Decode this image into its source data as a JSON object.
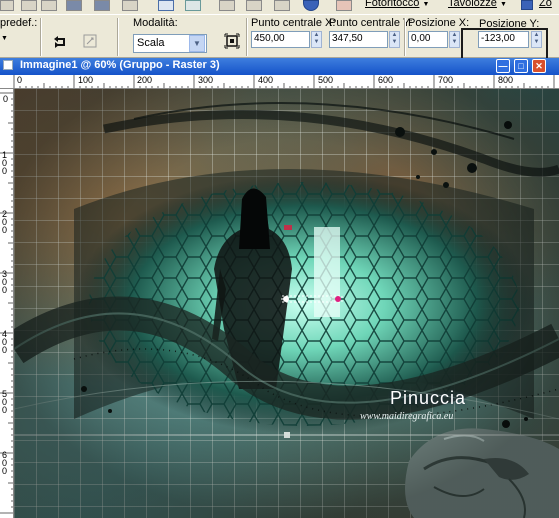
{
  "menu": {
    "photo_label": "Fotoritocco",
    "tables_label": "Tavolozze",
    "zoom_label": "Zo"
  },
  "options": {
    "preset_label": "predef.:",
    "mode_label": "Modalità:",
    "mode_value": "Scala",
    "center_x_label": "Punto centrale X:",
    "center_x_value": "450,00",
    "center_y_label": "Punto centrale Y:",
    "center_y_value": "347,50",
    "pos_x_label": "Posizione X:",
    "pos_x_value": "0,00",
    "pos_y_label": "Posizione Y:",
    "pos_y_value": "-123,00"
  },
  "document": {
    "title": "Immagine1 @ 60% (Gruppo - Raster 3)"
  },
  "ruler": {
    "top_labels": [
      "0",
      "100",
      "200",
      "300",
      "400",
      "500",
      "600",
      "700",
      "800"
    ],
    "left_labels": [
      "0",
      "1 0 0",
      "2 0 0",
      "3 0 0",
      "4 0 0",
      "5 0 0",
      "6 0 0"
    ]
  },
  "watermark": {
    "name": "Pinuccia",
    "url": "www.maidiregrafica.eu"
  },
  "colors": {
    "accent": "#1553c9",
    "highlight_border": "#1a1a1a",
    "teal_glow": "#7fe0c8"
  }
}
